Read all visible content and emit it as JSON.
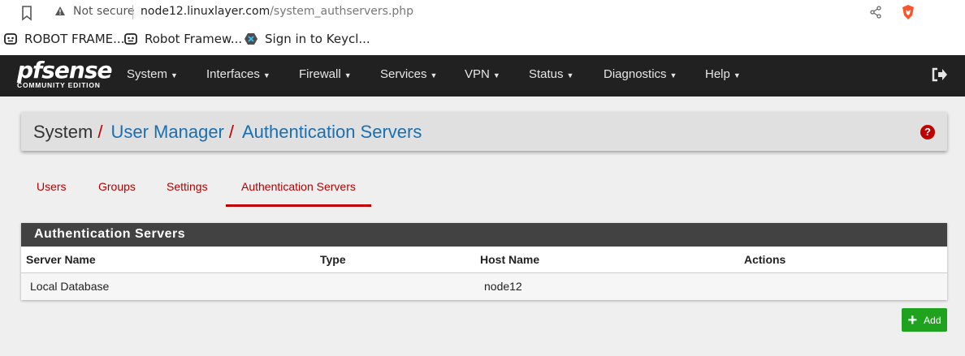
{
  "browser": {
    "not_secure": "Not secure",
    "url_host": "node12.linuxlayer.com",
    "url_path": "/system_authservers.php",
    "bookmarks": [
      {
        "label": "ROBOT FRAME...",
        "icon": "robot-icon"
      },
      {
        "label": "Robot Framew...",
        "icon": "robot-icon"
      },
      {
        "label": "Sign in to Keycl...",
        "icon": "keycloak-icon"
      }
    ]
  },
  "navbar": {
    "logo_brand": "pfsense",
    "logo_edition": "COMMUNITY EDITION",
    "menu": [
      "System",
      "Interfaces",
      "Firewall",
      "Services",
      "VPN",
      "Status",
      "Diagnostics",
      "Help"
    ]
  },
  "breadcrumb": {
    "root": "System",
    "level1": "User Manager",
    "level2": "Authentication Servers",
    "help": "?"
  },
  "tabs": [
    "Users",
    "Groups",
    "Settings",
    "Authentication Servers"
  ],
  "active_tab": "Authentication Servers",
  "panel": {
    "title": "Authentication Servers",
    "columns": [
      "Server Name",
      "Type",
      "Host Name",
      "Actions"
    ],
    "rows": [
      {
        "server_name": "Local Database",
        "type": "",
        "host_name": "node12",
        "actions": ""
      }
    ]
  },
  "add_button": "Add",
  "colors": {
    "navbar": "#212121",
    "accent_red": "#c00000",
    "link_blue": "#1a6fb0",
    "add_green": "#1fa31f"
  }
}
